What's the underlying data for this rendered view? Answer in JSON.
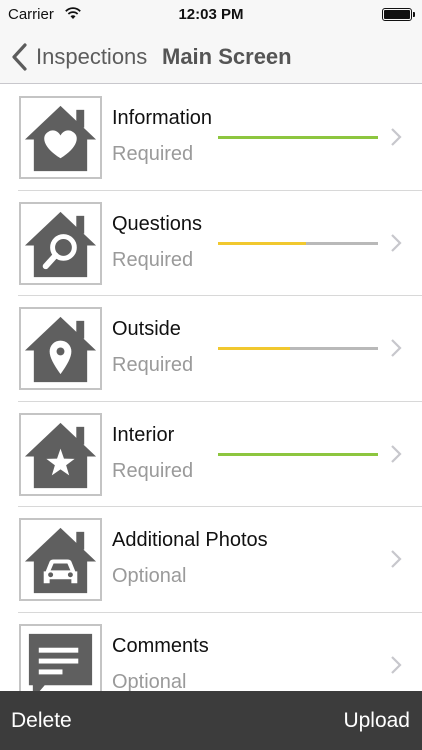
{
  "status_bar": {
    "carrier": "Carrier",
    "time": "12:03 PM"
  },
  "nav": {
    "back_label": "Inspections",
    "title": "Main Screen"
  },
  "colors": {
    "green": "#8dc63f",
    "yellow": "#f1c82f",
    "track": "#b9b9b9",
    "icon_gray": "#5f5f5f"
  },
  "rows": [
    {
      "title": "Information",
      "status": "Required",
      "icon": "house-heart-icon",
      "progress": 1.0,
      "progress_color": "#8dc63f"
    },
    {
      "title": "Questions",
      "status": "Required",
      "icon": "house-search-icon",
      "progress": 0.55,
      "progress_color": "#f1c82f"
    },
    {
      "title": "Outside",
      "status": "Required",
      "icon": "house-location-pin-icon",
      "progress": 0.45,
      "progress_color": "#f1c82f"
    },
    {
      "title": "Interior",
      "status": "Required",
      "icon": "house-star-icon",
      "progress": 1.0,
      "progress_color": "#8dc63f"
    },
    {
      "title": "Additional Photos",
      "status": "Optional",
      "icon": "house-car-icon",
      "progress": null
    },
    {
      "title": "Comments",
      "status": "Optional",
      "icon": "comment-bubble-icon",
      "progress": null
    }
  ],
  "toolbar": {
    "delete_label": "Delete",
    "upload_label": "Upload"
  }
}
